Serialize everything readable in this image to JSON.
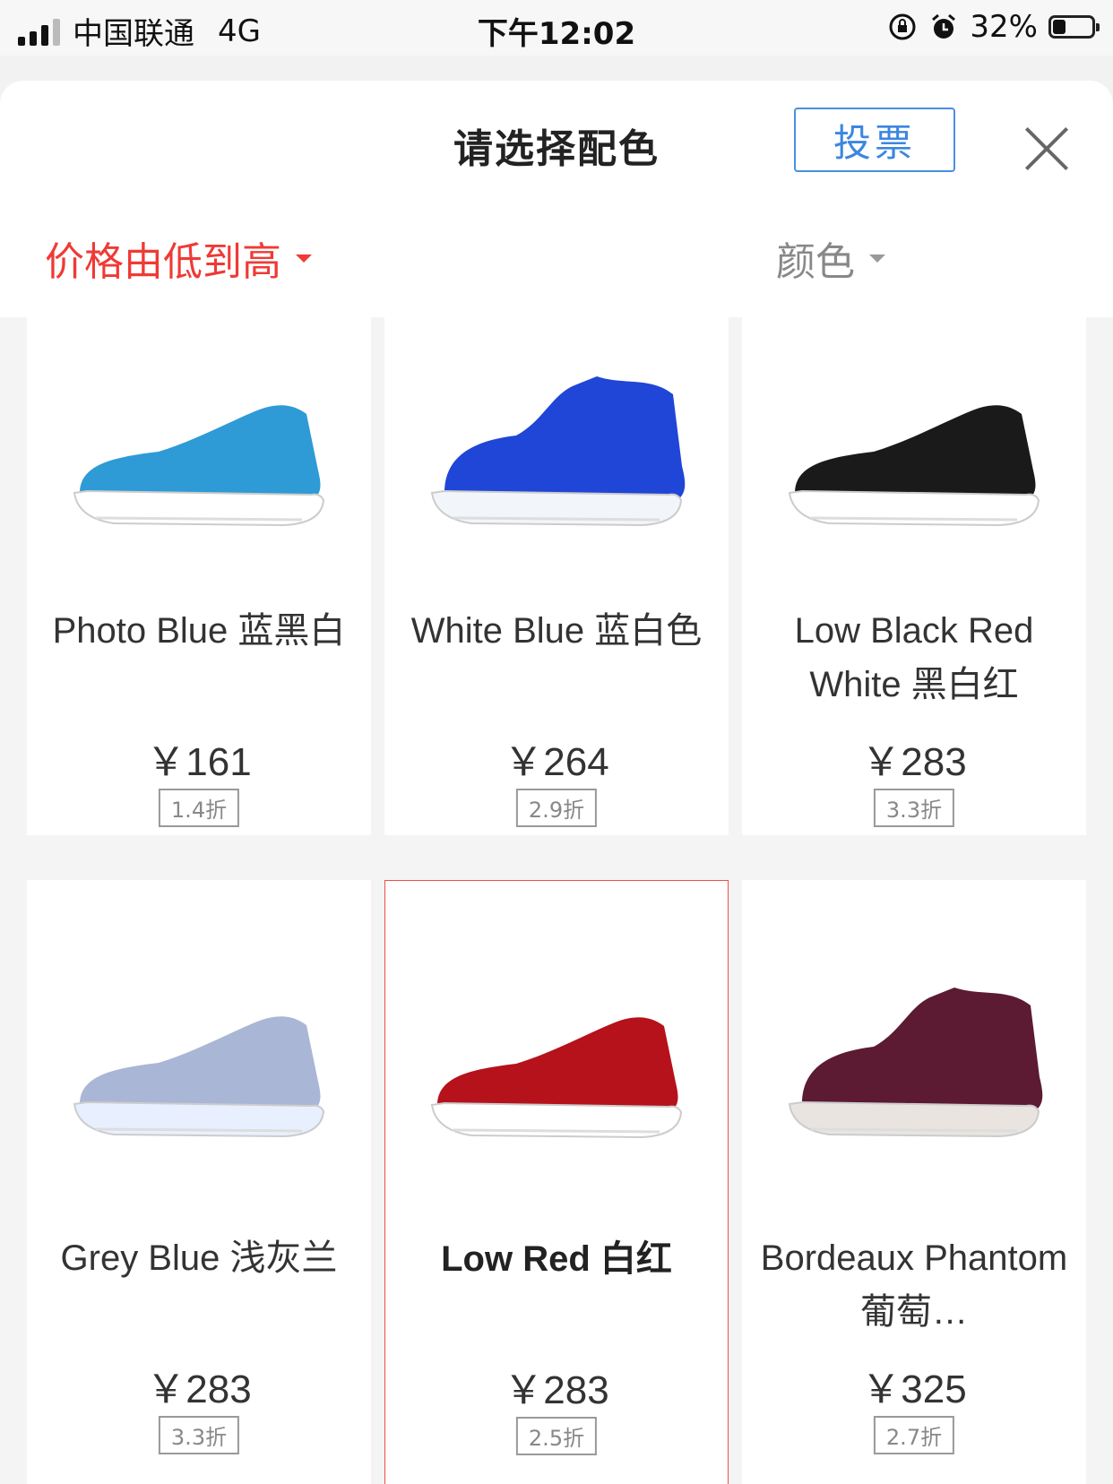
{
  "status_bar": {
    "carrier": "中国联通",
    "network": "4G",
    "time": "下午12:02",
    "battery": "32%",
    "battery_level": 0.32
  },
  "sheet": {
    "title": "请选择配色",
    "vote_label": "投票",
    "sort_options": [
      {
        "label": "价格由低到高",
        "active": true
      },
      {
        "label": "颜色",
        "active": false
      }
    ]
  },
  "colors": {
    "accent": "#ef3a35",
    "vote_blue": "#3b86e0",
    "selected_border": "#ef4f4a"
  },
  "products": [
    {
      "name": "Photo Blue 蓝黑白",
      "price": "￥161",
      "discount": "1.4折",
      "upper": "#2e9ad6",
      "sole": "#ffffff",
      "icon": "shoe-photo-blue-icon"
    },
    {
      "name": "White Blue 蓝白色",
      "price": "￥264",
      "discount": "2.9折",
      "upper": "#1f46d6",
      "sole": "#f2f5fa",
      "icon": "shoe-white-blue-icon"
    },
    {
      "name": "Low Black Red White 黑白红",
      "price": "￥283",
      "discount": "3.3折",
      "upper": "#1a1a1a",
      "sole": "#ffffff",
      "icon": "shoe-black-red-icon"
    },
    {
      "name": "Grey Blue 浅灰兰",
      "price": "￥283",
      "discount": "3.3折",
      "upper": "#aab6d6",
      "sole": "#e8f0ff",
      "icon": "shoe-grey-blue-icon"
    },
    {
      "name": "Low Red 白红",
      "price": "￥283",
      "discount": "2.5折",
      "upper": "#b5121b",
      "sole": "#ffffff",
      "icon": "shoe-low-red-icon",
      "selected": true
    },
    {
      "name": "Bordeaux Phantom 葡萄…",
      "price": "￥325",
      "discount": "2.7折",
      "upper": "#5c1a33",
      "sole": "#e9e4e0",
      "icon": "shoe-bordeaux-icon"
    }
  ]
}
